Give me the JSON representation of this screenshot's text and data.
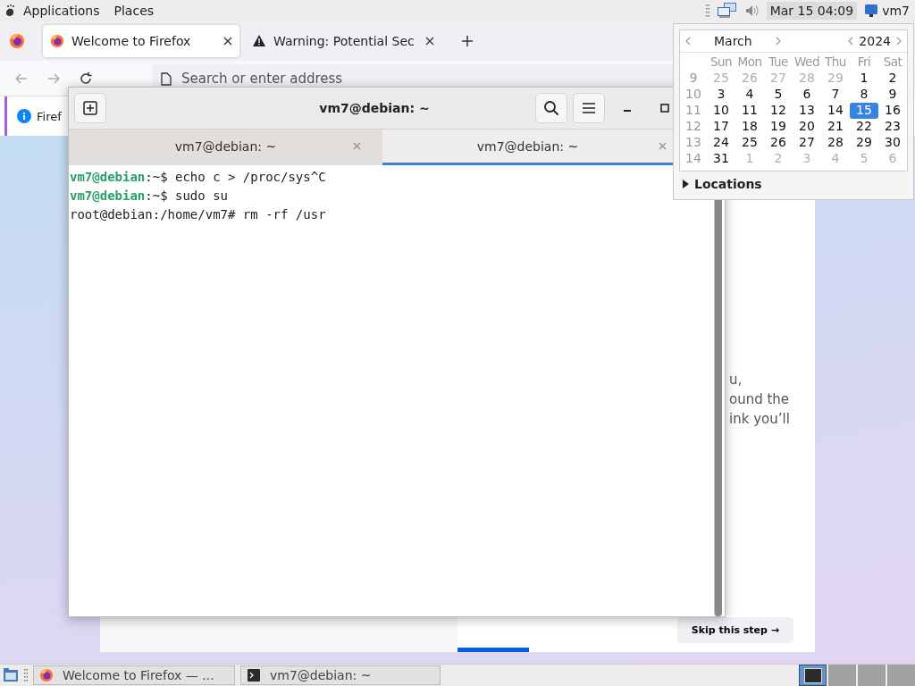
{
  "top_panel": {
    "menus": [
      "Applications",
      "Places"
    ],
    "clock": "Mar 15  04:09",
    "user": "vm7"
  },
  "browser": {
    "tabs": [
      {
        "title": "Welcome to Firefox",
        "kind": "firefox",
        "selected": true
      },
      {
        "title": "Warning: Potential Sec",
        "kind": "warning",
        "selected": false
      }
    ],
    "address_bar": {
      "placeholder": "Search or enter address"
    },
    "notification": {
      "text": "Firef"
    },
    "page": {
      "text_lines": [
        "u,",
        "ound the",
        "ink you’ll"
      ],
      "skip_button": "Skip this step →",
      "progress": {
        "level": 0.2
      }
    }
  },
  "terminal": {
    "title": "vm7@debian: ~",
    "tabs": [
      {
        "title": "vm7@debian: ~",
        "selected": false
      },
      {
        "title": "vm7@debian: ~",
        "selected": true
      }
    ],
    "lines": [
      {
        "kind": "user",
        "user": "vm7@debian",
        "text": ":~$ echo c > /proc/sys^C"
      },
      {
        "kind": "user",
        "user": "vm7@debian",
        "text": ":~$ sudo su"
      },
      {
        "kind": "plain",
        "text": "root@debian:/home/vm7# rm -rf /usr"
      }
    ]
  },
  "calendar": {
    "month": "March",
    "year": "2024",
    "weekdays": [
      "Sun",
      "Mon",
      "Tue",
      "Wed",
      "Thu",
      "Fri",
      "Sat"
    ],
    "weeks": [
      {
        "week": "9",
        "days": [
          {
            "day": "25",
            "dim": true,
            "selected": false
          },
          {
            "day": "26",
            "dim": true,
            "selected": false
          },
          {
            "day": "27",
            "dim": true,
            "selected": false
          },
          {
            "day": "28",
            "dim": true,
            "selected": false
          },
          {
            "day": "29",
            "dim": true,
            "selected": false
          },
          {
            "day": "1",
            "dim": false,
            "selected": false
          },
          {
            "day": "2",
            "dim": false,
            "selected": false
          }
        ]
      },
      {
        "week": "10",
        "days": [
          {
            "day": "3",
            "dim": false,
            "selected": false
          },
          {
            "day": "4",
            "dim": false,
            "selected": false
          },
          {
            "day": "5",
            "dim": false,
            "selected": false
          },
          {
            "day": "6",
            "dim": false,
            "selected": false
          },
          {
            "day": "7",
            "dim": false,
            "selected": false
          },
          {
            "day": "8",
            "dim": false,
            "selected": false
          },
          {
            "day": "9",
            "dim": false,
            "selected": false
          }
        ]
      },
      {
        "week": "11",
        "days": [
          {
            "day": "10",
            "dim": false,
            "selected": false
          },
          {
            "day": "11",
            "dim": false,
            "selected": false
          },
          {
            "day": "12",
            "dim": false,
            "selected": false
          },
          {
            "day": "13",
            "dim": false,
            "selected": false
          },
          {
            "day": "14",
            "dim": false,
            "selected": false
          },
          {
            "day": "15",
            "dim": false,
            "selected": true
          },
          {
            "day": "16",
            "dim": false,
            "selected": false
          }
        ]
      },
      {
        "week": "12",
        "days": [
          {
            "day": "17",
            "dim": false,
            "selected": false
          },
          {
            "day": "18",
            "dim": false,
            "selected": false
          },
          {
            "day": "19",
            "dim": false,
            "selected": false
          },
          {
            "day": "20",
            "dim": false,
            "selected": false
          },
          {
            "day": "21",
            "dim": false,
            "selected": false
          },
          {
            "day": "22",
            "dim": false,
            "selected": false
          },
          {
            "day": "23",
            "dim": false,
            "selected": false
          }
        ]
      },
      {
        "week": "13",
        "days": [
          {
            "day": "24",
            "dim": false,
            "selected": false
          },
          {
            "day": "25",
            "dim": false,
            "selected": false
          },
          {
            "day": "26",
            "dim": false,
            "selected": false
          },
          {
            "day": "27",
            "dim": false,
            "selected": false
          },
          {
            "day": "28",
            "dim": false,
            "selected": false
          },
          {
            "day": "29",
            "dim": false,
            "selected": false
          },
          {
            "day": "30",
            "dim": false,
            "selected": false
          }
        ]
      },
      {
        "week": "14",
        "days": [
          {
            "day": "31",
            "dim": false,
            "selected": false
          },
          {
            "day": "1",
            "dim": true,
            "selected": false
          },
          {
            "day": "2",
            "dim": true,
            "selected": false
          },
          {
            "day": "3",
            "dim": true,
            "selected": false
          },
          {
            "day": "4",
            "dim": true,
            "selected": false
          },
          {
            "day": "5",
            "dim": true,
            "selected": false
          },
          {
            "day": "6",
            "dim": true,
            "selected": false
          }
        ]
      }
    ],
    "locations": {
      "label": "Locations",
      "expanded": false
    }
  },
  "taskbar": {
    "tasks": [
      {
        "title": "Welcome to Firefox — ...",
        "kind": "firefox",
        "selected": false
      },
      {
        "title": "vm7@debian: ~",
        "kind": "terminal",
        "selected": false
      }
    ],
    "workspaces": [
      {
        "selected": true
      },
      {
        "selected": false
      },
      {
        "selected": false
      },
      {
        "selected": false
      }
    ]
  }
}
